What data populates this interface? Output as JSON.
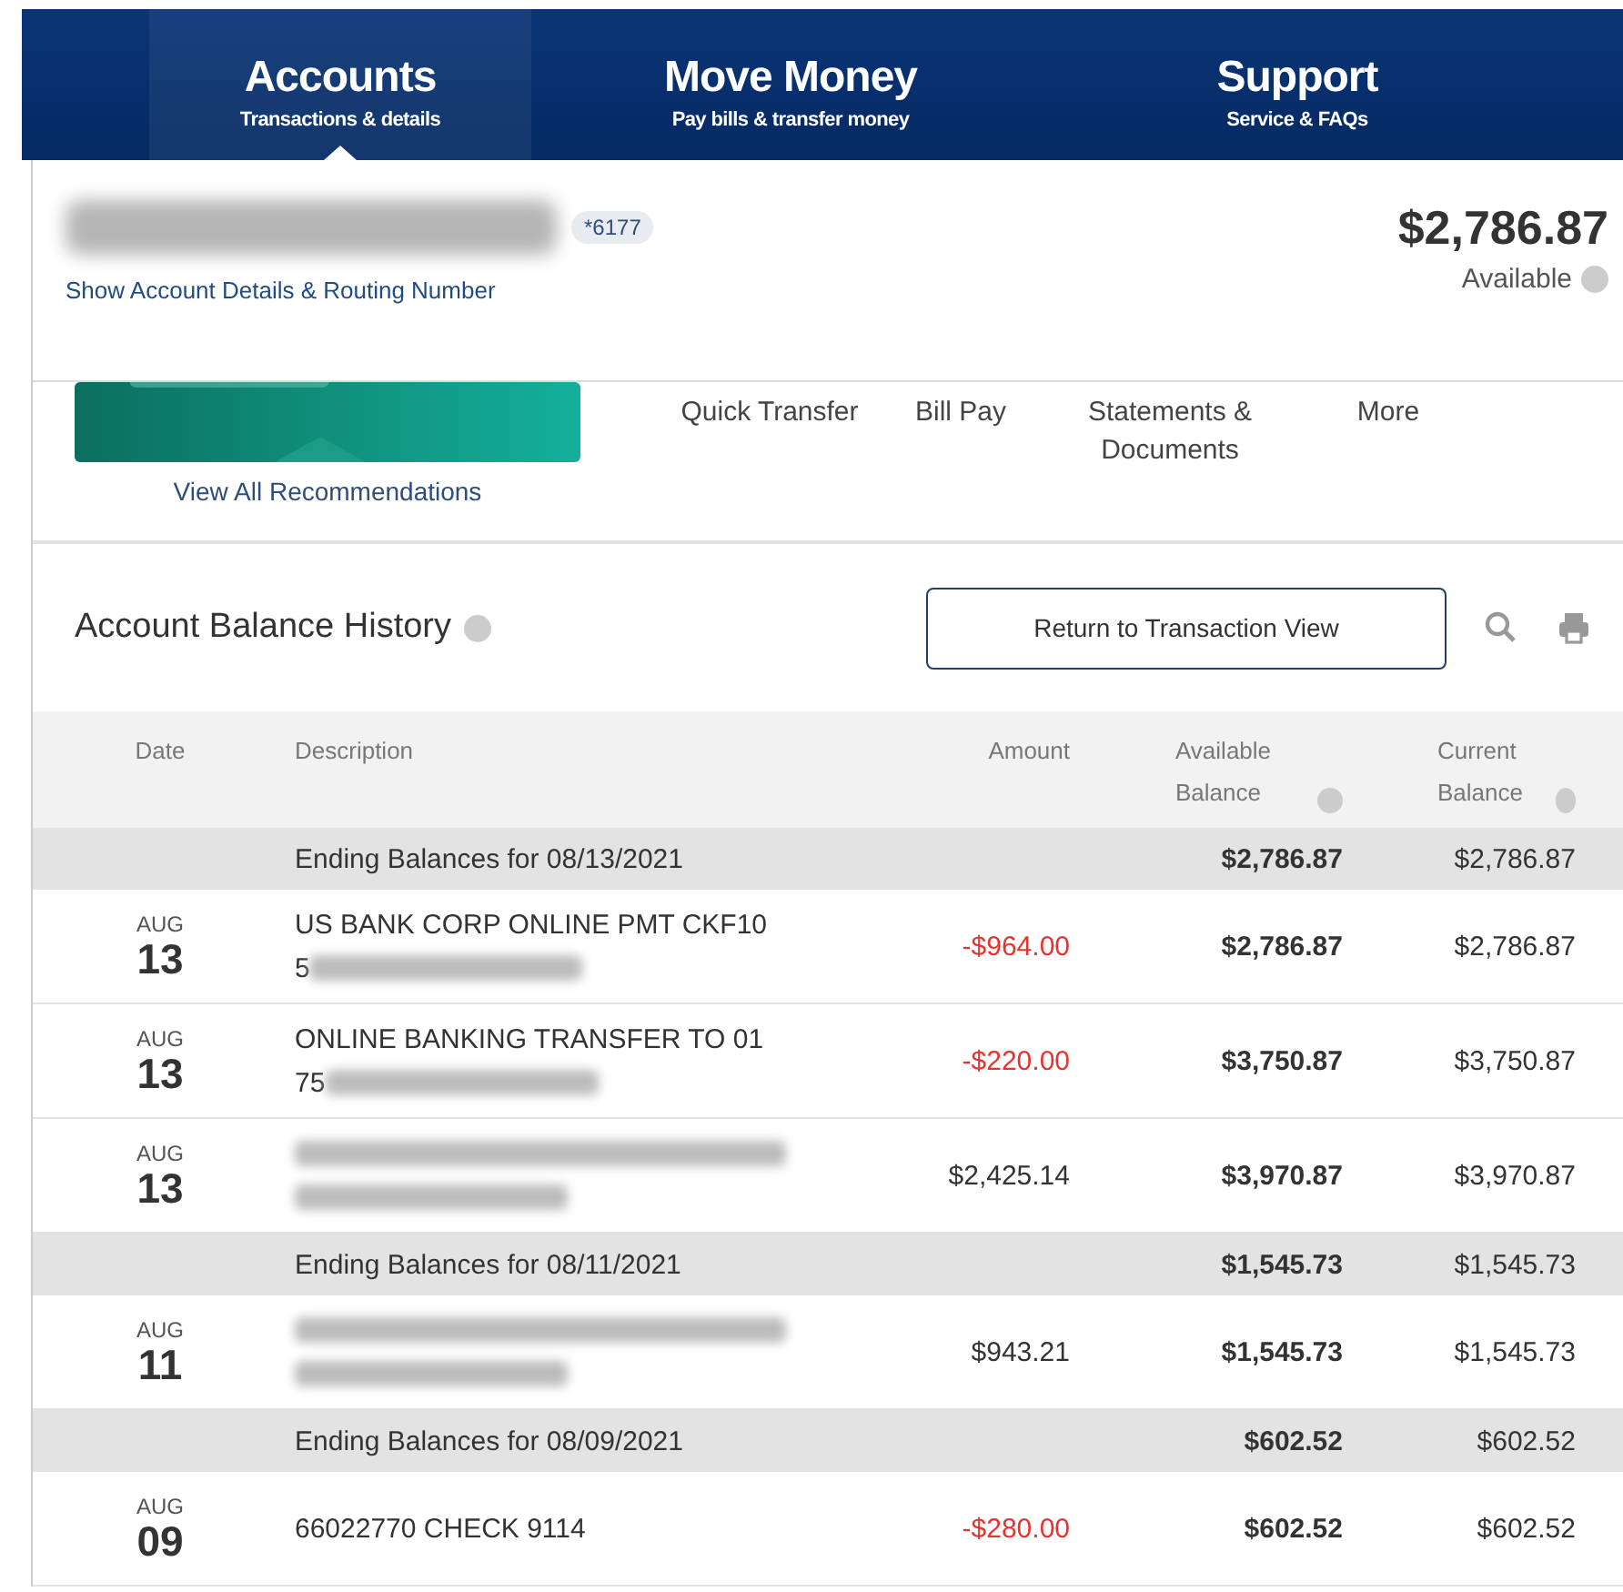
{
  "nav": [
    {
      "title": "Accounts",
      "subtitle": "Transactions & details",
      "selected": true
    },
    {
      "title": "Move Money",
      "subtitle": "Pay bills & transfer money",
      "selected": false
    },
    {
      "title": "Support",
      "subtitle": "Service & FAQs",
      "selected": false
    }
  ],
  "account": {
    "name_redacted": true,
    "number": "*6177",
    "details_link": "Show Account Details & Routing Number",
    "balance": "$2,786.87",
    "balance_label": "Available"
  },
  "recommendations_link": "View All Recommendations",
  "actions": [
    "Quick Transfer",
    "Bill Pay",
    "Statements & Documents",
    "More"
  ],
  "history": {
    "title": "Account Balance History",
    "return_button": "Return to Transaction View",
    "columns": [
      "Date",
      "Description",
      "Amount",
      "Available Balance",
      "Current Balance"
    ],
    "rows": [
      {
        "kind": "ending",
        "description": "Ending Balances for 08/13/2021",
        "available": "$2,786.87",
        "current": "$2,786.87"
      },
      {
        "kind": "transaction",
        "month": "AUG",
        "day": "13",
        "lines": [
          {
            "text": "US BANK CORP ONLINE PMT CKF10",
            "redacted": false
          },
          {
            "text": "5",
            "redacted": true
          }
        ],
        "amount": "-$964.00",
        "negative": true,
        "available": "$2,786.87",
        "current": "$2,786.87"
      },
      {
        "kind": "transaction",
        "month": "AUG",
        "day": "13",
        "lines": [
          {
            "text": "ONLINE BANKING TRANSFER TO 01",
            "redacted": false
          },
          {
            "text": "75",
            "redacted": true
          }
        ],
        "amount": "-$220.00",
        "negative": true,
        "available": "$3,750.87",
        "current": "$3,750.87"
      },
      {
        "kind": "transaction",
        "month": "AUG",
        "day": "13",
        "lines": [
          {
            "redacted": true
          },
          {
            "redacted": true
          }
        ],
        "amount": "$2,425.14",
        "negative": false,
        "available": "$3,970.87",
        "current": "$3,970.87"
      },
      {
        "kind": "ending",
        "description": "Ending Balances for 08/11/2021",
        "available": "$1,545.73",
        "current": "$1,545.73"
      },
      {
        "kind": "transaction",
        "month": "AUG",
        "day": "11",
        "lines": [
          {
            "redacted": true
          },
          {
            "redacted": true
          }
        ],
        "amount": "$943.21",
        "negative": false,
        "available": "$1,545.73",
        "current": "$1,545.73"
      },
      {
        "kind": "ending",
        "description": "Ending Balances for 08/09/2021",
        "available": "$602.52",
        "current": "$602.52"
      },
      {
        "kind": "transaction",
        "month": "AUG",
        "day": "09",
        "lines": [
          {
            "text": "66022770 CHECK 9114",
            "redacted": false
          }
        ],
        "amount": "-$280.00",
        "negative": true,
        "available": "$602.52",
        "current": "$602.52"
      }
    ]
  }
}
